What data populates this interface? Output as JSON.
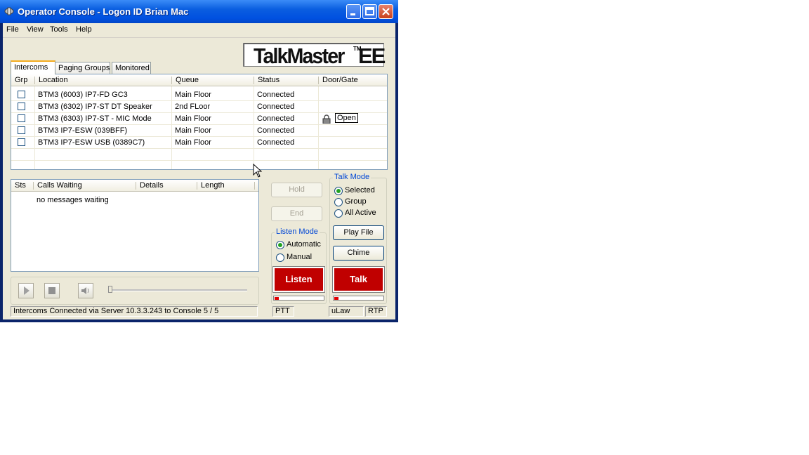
{
  "window": {
    "title": "Operator Console - Logon ID Brian Mac"
  },
  "menu": [
    "File",
    "View",
    "Tools",
    "Help"
  ],
  "logo": {
    "main": "TalkMaster",
    "tm": "TM",
    "suffix": "EE"
  },
  "tabs": [
    "Intercoms",
    "Paging Groups",
    "Monitored"
  ],
  "intercoms": {
    "columns": [
      "Grp",
      "Location",
      "Queue",
      "Status",
      "Door/Gate"
    ],
    "rows": [
      {
        "location": "BTM3 (6003) IP7-FD GC3",
        "queue": "Main Floor",
        "status": "Connected",
        "door": ""
      },
      {
        "location": "BTM3 (6302) IP7-ST DT Speaker",
        "queue": "2nd FLoor",
        "status": "Connected",
        "door": ""
      },
      {
        "location": "BTM3 (6303) IP7-ST - MIC Mode",
        "queue": "Main Floor",
        "status": "Connected",
        "door": "Open"
      },
      {
        "location": "BTM3 IP7-ESW (039BFF)",
        "queue": "Main Floor",
        "status": "Connected",
        "door": ""
      },
      {
        "location": "BTM3 IP7-ESW USB (0389C7)",
        "queue": "Main Floor",
        "status": "Connected",
        "door": ""
      }
    ]
  },
  "calls": {
    "columns": [
      "Sts",
      "Calls Waiting",
      "Details",
      "Length"
    ],
    "empty_text": "no messages waiting"
  },
  "buttons": {
    "hold": "Hold",
    "end": "End",
    "play_file": "Play File",
    "chime": "Chime",
    "listen": "Listen",
    "talk": "Talk"
  },
  "listen_mode": {
    "title": "Listen Mode",
    "options": [
      "Automatic",
      "Manual"
    ],
    "selected": "Automatic"
  },
  "talk_mode": {
    "title": "Talk Mode",
    "options": [
      "Selected",
      "Group",
      "All Active"
    ],
    "selected": "Selected"
  },
  "statusbar": {
    "message": "Intercoms Connected via Server 10.3.3.243 to Console 5 / 5",
    "ptt": "PTT",
    "codec": "uLaw",
    "protocol": "RTP"
  },
  "colors": {
    "accent_red": "#c00000",
    "title_blue": "#0050e0",
    "face": "#ece9d8"
  }
}
